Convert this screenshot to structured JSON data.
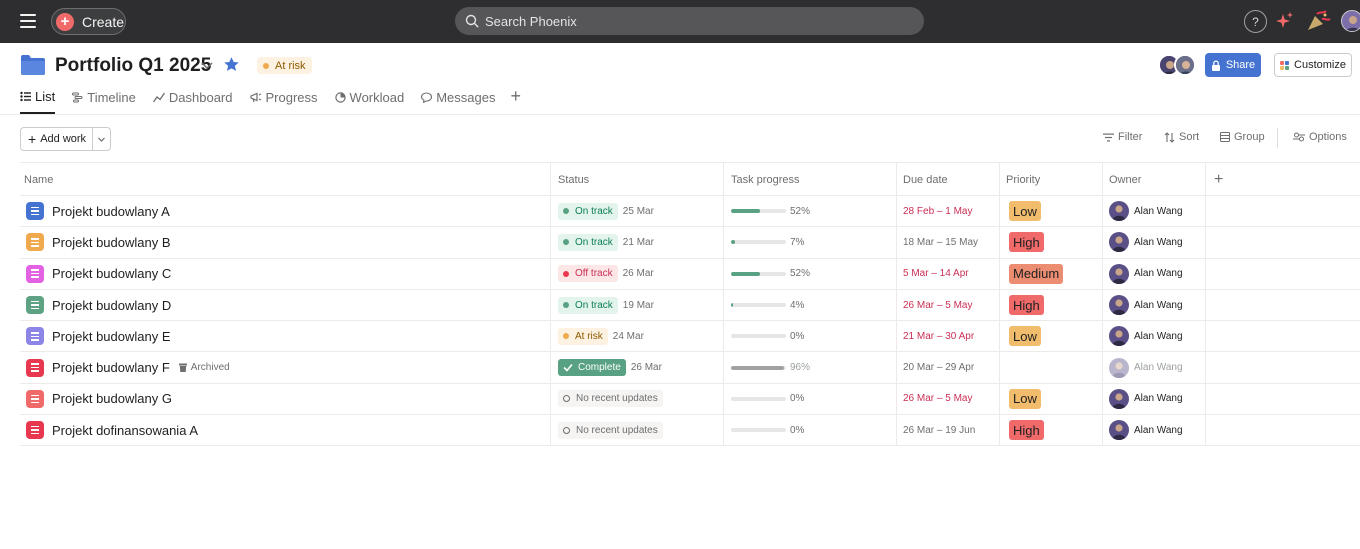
{
  "topbar": {
    "create_label": "Create",
    "search_placeholder": "Search Phoenix",
    "help_label": "?"
  },
  "header": {
    "title": "Portfolio Q1 2025",
    "status_label": "At risk",
    "share_label": "Share",
    "customize_label": "Customize"
  },
  "tabs": [
    {
      "label": "List",
      "icon": "list-icon",
      "active": true
    },
    {
      "label": "Timeline",
      "icon": "timeline-icon"
    },
    {
      "label": "Dashboard",
      "icon": "dashboard-icon"
    },
    {
      "label": "Progress",
      "icon": "progress-icon"
    },
    {
      "label": "Workload",
      "icon": "workload-icon"
    },
    {
      "label": "Messages",
      "icon": "messages-icon"
    }
  ],
  "toolbar": {
    "add_work_label": "Add work",
    "filter_label": "Filter",
    "sort_label": "Sort",
    "group_label": "Group",
    "options_label": "Options"
  },
  "table": {
    "columns": [
      "Name",
      "Status",
      "Task progress",
      "Due date",
      "Priority",
      "Owner"
    ],
    "rows": [
      {
        "name": "Projekt budowlany A",
        "icon_color": "#4573d2",
        "status": "On track",
        "status_date": "25 Mar",
        "progress": 0.52,
        "progress_label": "52%",
        "due": "28 Feb – 1 May",
        "due_overdue": true,
        "priority": "Low",
        "owner": "Alan Wang"
      },
      {
        "name": "Projekt budowlany B",
        "icon_color": "#f1a94e",
        "status": "On track",
        "status_date": "21 Mar",
        "progress": 0.07,
        "progress_label": "7%",
        "due": "18 Mar – 15 May",
        "due_overdue": false,
        "priority": "High",
        "owner": "Alan Wang"
      },
      {
        "name": "Projekt budowlany C",
        "icon_color": "#e362e3",
        "status": "Off track",
        "status_date": "26 Mar",
        "progress": 0.52,
        "progress_label": "52%",
        "due": "5 Mar – 14 Apr",
        "due_overdue": true,
        "priority": "Medium",
        "owner": "Alan Wang"
      },
      {
        "name": "Projekt budowlany D",
        "icon_color": "#5da283",
        "status": "On track",
        "status_date": "19 Mar",
        "progress": 0.04,
        "progress_label": "4%",
        "due": "26 Mar – 5 May",
        "due_overdue": true,
        "priority": "High",
        "owner": "Alan Wang"
      },
      {
        "name": "Projekt budowlany E",
        "icon_color": "#8d84e8",
        "status": "At risk",
        "status_date": "24 Mar",
        "progress": 0,
        "progress_label": "0%",
        "due": "21 Mar – 30 Apr",
        "due_overdue": true,
        "priority": "Low",
        "owner": "Alan Wang"
      },
      {
        "name": "Projekt budowlany F",
        "icon_color": "#e8384f",
        "archived_label": "Archived",
        "status": "Complete",
        "status_date": "26 Mar",
        "progress": 0.96,
        "progress_label": "96%",
        "due": "20 Mar – 29 Apr",
        "due_overdue": false,
        "priority": "",
        "owner": "Alan Wang"
      },
      {
        "name": "Projekt budowlany G",
        "icon_color": "#f06a6a",
        "status": "No recent updates",
        "status_date": "",
        "progress": 0,
        "progress_label": "0%",
        "due": "26 Mar – 5 May",
        "due_overdue": true,
        "priority": "Low",
        "owner": "Alan Wang"
      },
      {
        "name": "Projekt dofinansowania A",
        "icon_color": "#e8384f",
        "status": "No recent updates",
        "status_date": "",
        "progress": 0,
        "progress_label": "0%",
        "due": "26 Mar – 19 Jun",
        "due_overdue": false,
        "priority": "High",
        "owner": "Alan Wang"
      }
    ]
  },
  "colors": {
    "on_track_bg": "#e3f4ec",
    "on_track_fg": "#0d7f56",
    "on_track_dot": "#58a182",
    "off_track_bg": "#fde6e6",
    "off_track_fg": "#c92f54",
    "off_track_dot": "#e8384f",
    "at_risk_bg": "#fdf1e1",
    "at_risk_fg": "#8d5a00",
    "at_risk_dot": "#f1a94e",
    "complete_bg": "#58a182",
    "complete_fg": "#ffffff",
    "none_bg": "#f5f4f3",
    "none_fg": "#6d6e6f",
    "progress_fill": "#58a182",
    "progress_fill_archived": "#a2a0a2",
    "due_overdue": "#c92f54",
    "due_normal": "#6d6e6f",
    "priority_low": "#f1bd6c",
    "priority_high": "#f06a6a",
    "priority_medium": "#ec8d71"
  }
}
